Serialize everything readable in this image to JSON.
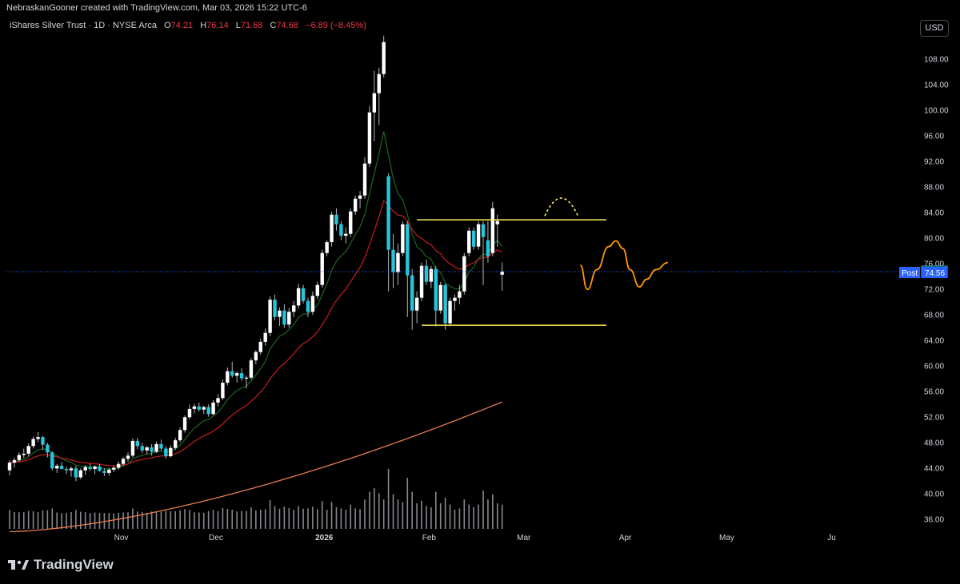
{
  "header": {
    "banner": "NebraskanGooner created with TradingView.com, Mar 03, 2026 15:22 UTC-6",
    "symbol": "iShares Silver Trust · 1D · NYSE Arca",
    "o_label": "O",
    "o_value": "74.21",
    "h_label": "H",
    "h_value": "76.14",
    "l_label": "L",
    "l_value": "71.68",
    "c_label": "C",
    "c_value": "74.68",
    "change": "−6.89 (−8.45%)"
  },
  "currency_button": "USD",
  "footer": {
    "brand": "TradingView"
  },
  "colors": {
    "up_body": "#ffffff",
    "down_body": "#26c6da",
    "wick": "#b2b5be",
    "ema_fast": "#1b5e20",
    "ema_mid": "#b71c1c",
    "sma_long": "#e57c4f",
    "level_line": "#ffee58",
    "projection": "#ff9800",
    "price_line": "#2962ff",
    "volume": "#b2b5be"
  },
  "chart_data": {
    "type": "candlestick",
    "interval": "1D",
    "ylim": [
      34,
      111
    ],
    "y_ticks": [
      "108.00",
      "104.00",
      "100.00",
      "96.00",
      "92.00",
      "88.00",
      "84.00",
      "80.00",
      "76.00",
      "72.00",
      "68.00",
      "64.00",
      "60.00",
      "56.00",
      "52.00",
      "48.00",
      "44.00",
      "40.00",
      "36.00"
    ],
    "x_ticks": [
      {
        "label": "Nov",
        "date": "2025-11-03"
      },
      {
        "label": "Dec",
        "date": "2025-12-01"
      },
      {
        "label": "2026",
        "date": "2026-01-02"
      },
      {
        "label": "Feb",
        "date": "2026-02-02"
      },
      {
        "label": "Mar",
        "date": "2026-03-02"
      },
      {
        "label": "Apr",
        "date": "2026-04-01"
      },
      {
        "label": "May",
        "date": "2026-05-01"
      },
      {
        "label": "Ju",
        "date": "2026-06-01"
      }
    ],
    "last_price": {
      "label": "74.68",
      "value": 74.68
    },
    "post_price": {
      "tag": "Post",
      "label": "74.56",
      "value": 74.56
    },
    "candles": [
      [
        43.6,
        45.2,
        42.8,
        44.8
      ],
      [
        44.8,
        45.6,
        44.0,
        45.2
      ],
      [
        45.2,
        46.4,
        44.9,
        46.0
      ],
      [
        46.0,
        47.0,
        45.5,
        46.2
      ],
      [
        46.2,
        47.8,
        45.8,
        47.4
      ],
      [
        47.4,
        48.9,
        47.0,
        48.5
      ],
      [
        48.5,
        49.6,
        48.0,
        48.8
      ],
      [
        48.8,
        49.0,
        46.8,
        47.6
      ],
      [
        47.6,
        47.9,
        45.6,
        46.4
      ],
      [
        46.4,
        46.6,
        43.6,
        43.9
      ],
      [
        43.9,
        44.6,
        43.2,
        44.3
      ],
      [
        44.3,
        44.9,
        43.8,
        43.8
      ],
      [
        43.8,
        44.2,
        43.0,
        43.6
      ],
      [
        43.6,
        44.2,
        42.6,
        43.9
      ],
      [
        43.9,
        44.3,
        41.9,
        42.5
      ],
      [
        42.5,
        43.9,
        42.2,
        43.6
      ],
      [
        43.6,
        44.4,
        42.9,
        44.1
      ],
      [
        44.1,
        44.7,
        43.5,
        43.8
      ],
      [
        43.8,
        44.4,
        43.0,
        44.2
      ],
      [
        44.2,
        44.6,
        43.4,
        43.5
      ],
      [
        43.5,
        43.9,
        42.7,
        43.2
      ],
      [
        43.2,
        44.0,
        42.8,
        43.7
      ],
      [
        43.7,
        44.3,
        43.3,
        44.0
      ],
      [
        44.0,
        45.0,
        43.7,
        44.6
      ],
      [
        44.6,
        45.7,
        44.3,
        45.4
      ],
      [
        45.4,
        46.4,
        44.9,
        45.9
      ],
      [
        45.9,
        48.6,
        45.6,
        48.2
      ],
      [
        48.2,
        48.7,
        46.9,
        47.4
      ],
      [
        47.4,
        47.9,
        46.3,
        46.7
      ],
      [
        46.7,
        47.4,
        46.1,
        47.2
      ],
      [
        47.2,
        47.7,
        45.9,
        46.5
      ],
      [
        46.5,
        48.1,
        46.3,
        47.7
      ],
      [
        47.7,
        48.4,
        46.7,
        47.0
      ],
      [
        47.0,
        47.4,
        45.4,
        45.8
      ],
      [
        45.8,
        47.5,
        45.6,
        47.1
      ],
      [
        47.1,
        48.7,
        46.8,
        48.3
      ],
      [
        48.3,
        50.3,
        48.0,
        49.9
      ],
      [
        49.9,
        52.2,
        49.5,
        51.9
      ],
      [
        51.9,
        53.9,
        51.6,
        53.2
      ],
      [
        53.2,
        54.0,
        52.5,
        53.6
      ],
      [
        53.6,
        54.2,
        52.8,
        53.1
      ],
      [
        53.1,
        53.7,
        52.4,
        53.5
      ],
      [
        53.5,
        53.9,
        52.0,
        52.4
      ],
      [
        52.4,
        54.6,
        52.2,
        54.2
      ],
      [
        54.2,
        55.5,
        53.6,
        54.9
      ],
      [
        54.9,
        57.8,
        54.6,
        57.3
      ],
      [
        57.3,
        59.7,
        56.9,
        59.1
      ],
      [
        59.1,
        60.6,
        58.1,
        58.4
      ],
      [
        58.4,
        59.1,
        57.3,
        58.8
      ],
      [
        58.8,
        59.6,
        57.6,
        58.0
      ],
      [
        58.0,
        58.4,
        56.4,
        58.1
      ],
      [
        58.1,
        61.2,
        57.8,
        60.8
      ],
      [
        60.8,
        62.4,
        60.2,
        62.1
      ],
      [
        62.1,
        64.2,
        61.7,
        63.7
      ],
      [
        63.7,
        65.8,
        63.1,
        65.1
      ],
      [
        65.1,
        70.8,
        64.6,
        70.3
      ],
      [
        70.3,
        71.1,
        67.1,
        67.6
      ],
      [
        67.6,
        69.1,
        66.2,
        68.6
      ],
      [
        68.6,
        69.6,
        65.9,
        66.4
      ],
      [
        66.4,
        69.0,
        65.9,
        68.4
      ],
      [
        68.4,
        70.1,
        67.6,
        69.4
      ],
      [
        69.4,
        72.8,
        68.9,
        72.1
      ],
      [
        72.1,
        72.6,
        69.7,
        70.1
      ],
      [
        70.1,
        70.6,
        67.6,
        68.4
      ],
      [
        68.4,
        71.6,
        67.9,
        70.9
      ],
      [
        70.9,
        73.1,
        70.4,
        72.6
      ],
      [
        72.6,
        78.1,
        72.2,
        77.6
      ],
      [
        77.6,
        79.6,
        77.1,
        79.3
      ],
      [
        79.3,
        84.1,
        78.6,
        83.6
      ],
      [
        83.6,
        84.6,
        81.1,
        82.1
      ],
      [
        82.1,
        82.6,
        79.6,
        80.3
      ],
      [
        80.3,
        81.6,
        79.1,
        80.6
      ],
      [
        80.6,
        84.6,
        80.1,
        84.1
      ],
      [
        84.1,
        86.6,
        83.6,
        86.1
      ],
      [
        86.1,
        87.3,
        84.6,
        86.6
      ],
      [
        86.6,
        92.6,
        86.1,
        91.6
      ],
      [
        91.6,
        100.6,
        91.1,
        99.6
      ],
      [
        99.6,
        106.1,
        95.1,
        102.6
      ],
      [
        102.6,
        106.6,
        97.6,
        105.6
      ],
      [
        105.6,
        111.6,
        105.1,
        110.6
      ],
      [
        89.6,
        90.1,
        71.6,
        78.1
      ],
      [
        78.1,
        80.6,
        72.1,
        74.6
      ],
      [
        74.6,
        79.1,
        72.6,
        77.6
      ],
      [
        77.6,
        82.6,
        77.1,
        82.1
      ],
      [
        82.1,
        82.6,
        67.6,
        74.1
      ],
      [
        74.1,
        75.1,
        65.6,
        68.6
      ],
      [
        68.6,
        71.6,
        66.6,
        70.6
      ],
      [
        70.6,
        76.1,
        70.1,
        75.6
      ],
      [
        75.6,
        76.6,
        72.6,
        73.1
      ],
      [
        73.1,
        75.6,
        72.1,
        75.1
      ],
      [
        75.1,
        75.6,
        66.1,
        68.6
      ],
      [
        68.6,
        73.1,
        68.1,
        72.6
      ],
      [
        72.6,
        72.8,
        65.6,
        66.6
      ],
      [
        66.6,
        70.6,
        66.1,
        70.1
      ],
      [
        70.1,
        71.1,
        68.6,
        70.6
      ],
      [
        70.6,
        72.6,
        69.6,
        71.6
      ],
      [
        71.6,
        77.6,
        71.1,
        77.1
      ],
      [
        77.6,
        81.6,
        77.1,
        81.1
      ],
      [
        81.1,
        81.6,
        78.1,
        78.6
      ],
      [
        78.6,
        82.6,
        78.1,
        82.1
      ],
      [
        82.1,
        82.6,
        72.6,
        80.1
      ],
      [
        79.6,
        82.6,
        76.1,
        77.1
      ],
      [
        77.6,
        85.6,
        77.1,
        84.6
      ],
      [
        82.1,
        83.6,
        78.6,
        82.6
      ],
      [
        74.21,
        76.14,
        71.68,
        74.68
      ]
    ],
    "moving_averages": [
      {
        "kind": "ema_fast",
        "color": "#1b5e20"
      },
      {
        "kind": "ema_mid",
        "color": "#b71c1c"
      },
      {
        "kind": "sma_long",
        "color": "#e57c4f"
      }
    ],
    "annotations": [
      {
        "type": "horizontal_segment",
        "value": 82.8,
        "from_bar": 86,
        "to_bar": 126,
        "color": "#ffee58"
      },
      {
        "type": "horizontal_segment",
        "value": 66.3,
        "from_bar": 87,
        "to_bar": 126,
        "color": "#ffee58"
      },
      {
        "type": "dashed_arc",
        "from_bar": 113,
        "to_bar": 120,
        "base": 83.4,
        "peak": 86.2,
        "color": "#ffee58"
      },
      {
        "type": "projection_path",
        "color": "#ff9800",
        "points": [
          [
            120.5,
            75.7
          ],
          [
            122,
            71.9
          ],
          [
            124,
            75
          ],
          [
            126.5,
            78.6
          ],
          [
            128,
            79.5
          ],
          [
            129.5,
            78.3
          ],
          [
            131,
            75
          ],
          [
            133,
            72.3
          ],
          [
            134.5,
            73.5
          ],
          [
            136.5,
            75
          ],
          [
            139,
            76.1
          ]
        ]
      }
    ]
  }
}
